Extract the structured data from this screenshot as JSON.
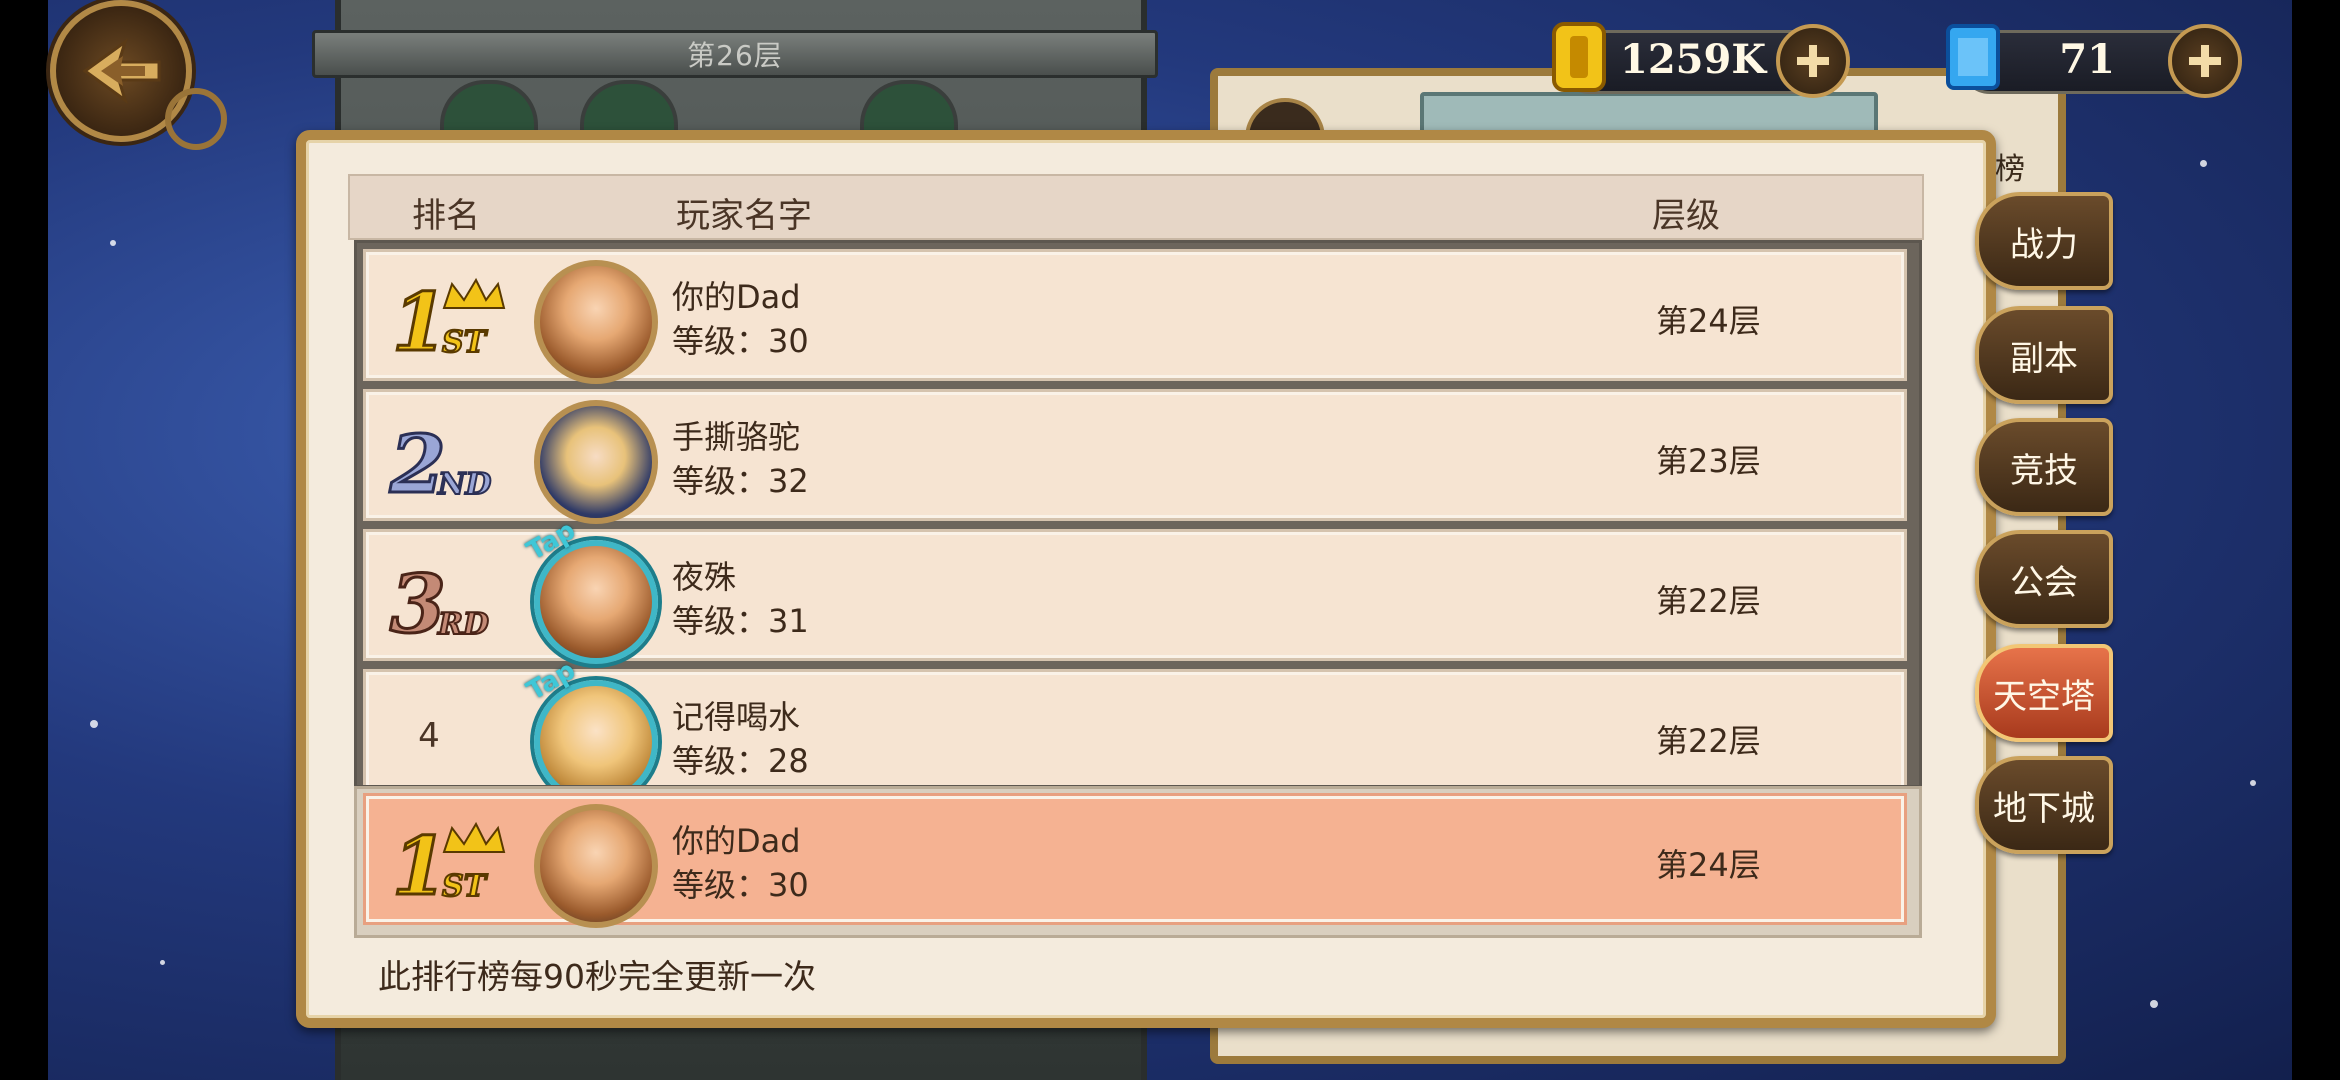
{
  "top": {
    "floor_label": "第26层",
    "gold_value": "1259K",
    "gem_value": "71",
    "back_icon": "back-arrow-icon",
    "gold_icon": "gold-coin-icon",
    "gem_icon": "blue-gem-icon",
    "plus_icon": "plus-icon"
  },
  "background_panel": {
    "rank_tag": "行榜"
  },
  "table": {
    "headers": {
      "rank": "排名",
      "player": "玩家名字",
      "floor": "层级"
    },
    "rows": [
      {
        "rank": "1ST",
        "name": "你的Dad",
        "level": "等级：30",
        "floor": "第24层",
        "avatar": "blond-hero-avatar",
        "tap": false
      },
      {
        "rank": "2ND",
        "name": "手撕骆驼",
        "level": "等级：32",
        "floor": "第23层",
        "avatar": "nun-avatar",
        "tap": false
      },
      {
        "rank": "3RD",
        "name": "夜殊",
        "level": "等级：31",
        "floor": "第22层",
        "avatar": "blond-hero-avatar",
        "tap": true,
        "tap_label": "Tap"
      },
      {
        "rank": "4",
        "name": "记得喝水",
        "level": "等级：28",
        "floor": "第22层",
        "avatar": "blond-girl-avatar",
        "tap": true,
        "tap_label": "Tap"
      }
    ],
    "self": {
      "rank": "1ST",
      "name": "你的Dad",
      "level": "等级：30",
      "floor": "第24层"
    }
  },
  "footer_note": "此排行榜每90秒完全更新一次",
  "tabs": [
    {
      "label": "战力",
      "active": false
    },
    {
      "label": "副本",
      "active": false
    },
    {
      "label": "竞技",
      "active": false
    },
    {
      "label": "公会",
      "active": false
    },
    {
      "label": "天空塔",
      "active": true
    },
    {
      "label": "地下城",
      "active": false
    }
  ],
  "colors": {
    "gold": "#f2c318",
    "silver": "#8b98c8",
    "bronze": "#b07a66",
    "active_tab": "#d45a33"
  }
}
